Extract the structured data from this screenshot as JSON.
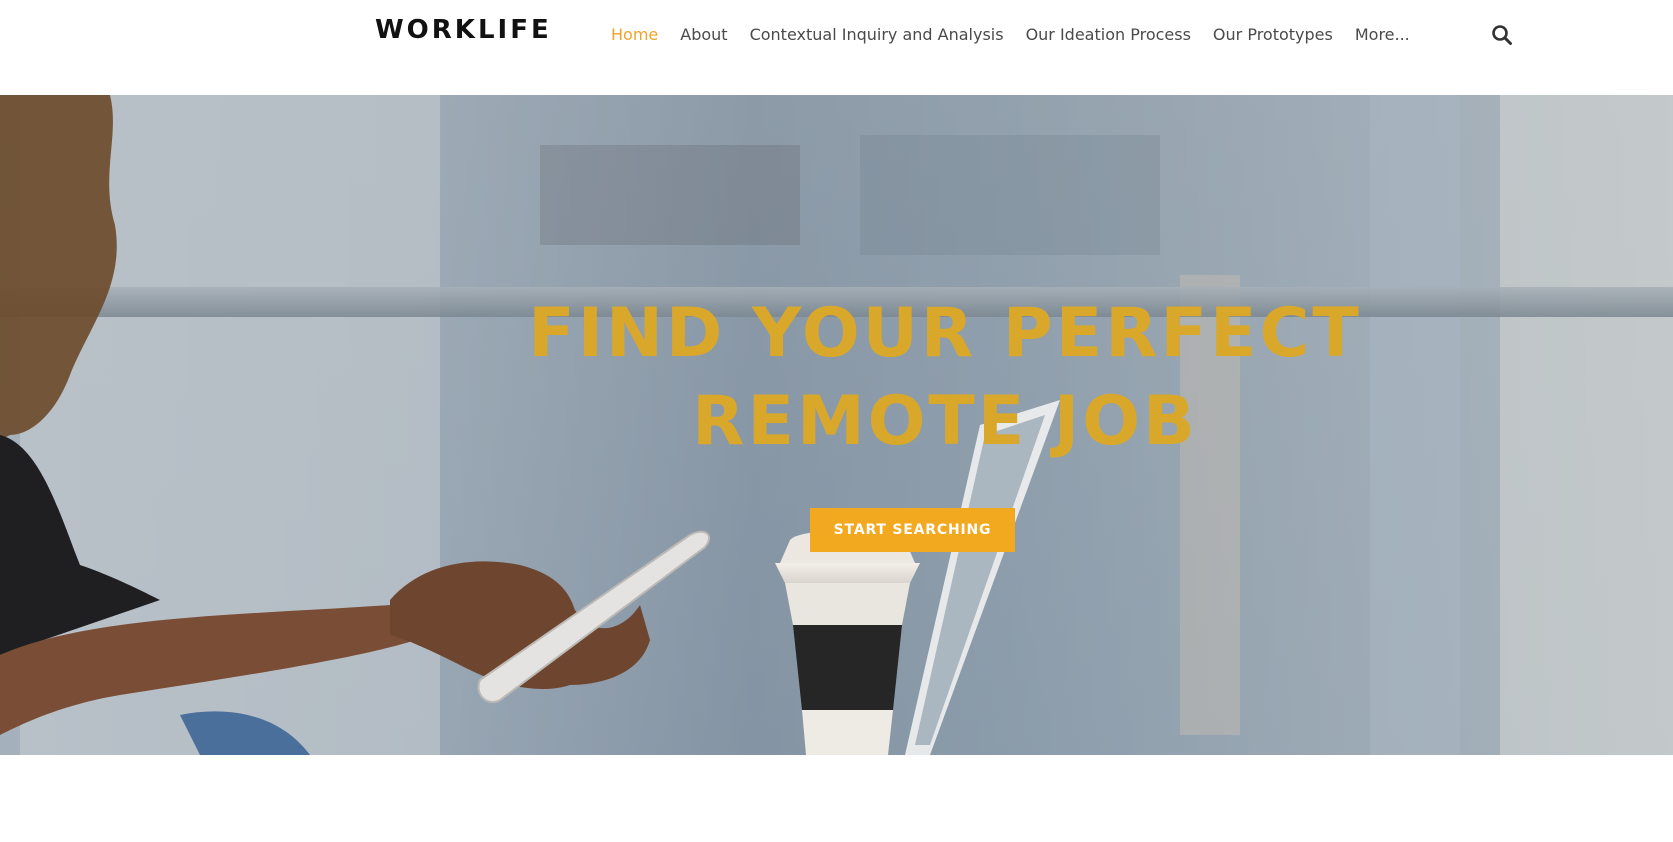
{
  "brand": {
    "logo_text": "WORKLIFE"
  },
  "nav": {
    "items": [
      {
        "label": "Home",
        "active": true
      },
      {
        "label": "About"
      },
      {
        "label": "Contextual Inquiry and Analysis"
      },
      {
        "label": "Our Ideation Process"
      },
      {
        "label": "Our Prototypes"
      },
      {
        "label": "More..."
      }
    ],
    "search_icon": "search-icon"
  },
  "hero": {
    "title_line1": "FIND YOUR PERFECT",
    "title_line2": "REMOTE JOB",
    "cta_label": "START SEARCHING",
    "image": "woman-holding-phone-with-coffee-cup-and-laptop"
  },
  "colors": {
    "accent": "#f2a81f",
    "nav_active": "#f0a32a",
    "title": "#d9a82a",
    "nav_text": "#4a4a4a",
    "logo": "#111111"
  }
}
